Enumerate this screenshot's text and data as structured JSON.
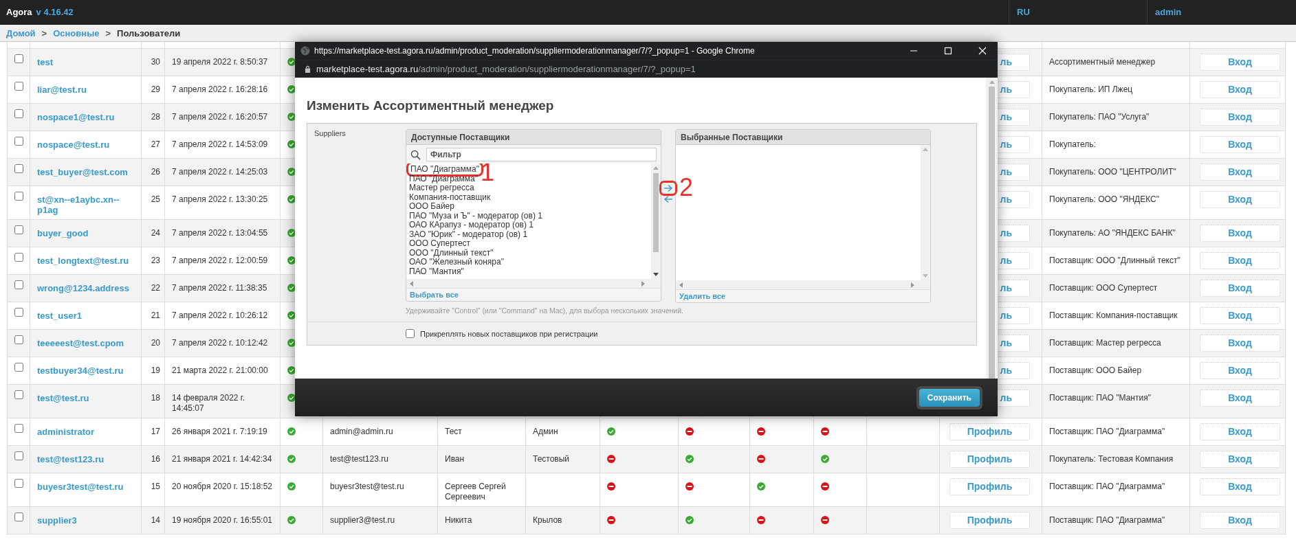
{
  "app": {
    "name": "Agora",
    "version": "v 4.16.42",
    "language": "RU",
    "user": "admin"
  },
  "breadcrumbs": [
    {
      "label": "Домой",
      "link": true
    },
    {
      "label": "Основные",
      "link": true
    },
    {
      "label": "Пользователи",
      "link": false
    }
  ],
  "breadcrumb_separator": ">",
  "users": [
    {
      "kind": "covered",
      "checked": false,
      "name": "test",
      "id": "30",
      "date": "19 апреля 2022 г. 8:50:37",
      "active": true,
      "profile": "ль",
      "role": "Ассортиментный менеджер",
      "login": "Вход"
    },
    {
      "kind": "covered",
      "checked": false,
      "name": "liar@test.ru",
      "id": "29",
      "date": "7 апреля 2022 г. 16:28:16",
      "active": true,
      "profile": "ль",
      "role": "Покупатель: ИП Лжец",
      "login": "Вход"
    },
    {
      "kind": "covered",
      "checked": false,
      "name": "nospace1@test.ru",
      "id": "28",
      "date": "7 апреля 2022 г. 16:20:57",
      "active": true,
      "profile": "ль",
      "role": "Покупатель: ПАО \"Услуга\"",
      "login": "Вход"
    },
    {
      "kind": "covered",
      "checked": false,
      "name": "nospace@test.ru",
      "id": "27",
      "date": "7 апреля 2022 г. 14:53:09",
      "active": true,
      "profile": "ль",
      "role": "Покупатель:",
      "login": "Вход"
    },
    {
      "kind": "covered",
      "checked": false,
      "name": "test_buyer@test.com",
      "id": "26",
      "date": "7 апреля 2022 г. 14:25:03",
      "active": true,
      "profile": "ль",
      "role": "Покупатель: ООО \"ЦЕНТРОЛИТ\"",
      "login": "Вход"
    },
    {
      "kind": "covered",
      "checked": false,
      "name": "st@xn--e1aybc.xn--p1ag",
      "id": "25",
      "date": "7 апреля 2022 г. 13:30:25",
      "active": true,
      "profile": "ль",
      "role": "Покупатель: ООО \"ЯНДЕКС\"",
      "login": "Вход"
    },
    {
      "kind": "covered",
      "checked": false,
      "name": "buyer_good",
      "id": "24",
      "date": "7 апреля 2022 г. 13:04:55",
      "active": true,
      "profile": "ль",
      "role": "Покупатель: АО \"ЯНДЕКС БАНК\"",
      "login": "Вход"
    },
    {
      "kind": "covered",
      "checked": false,
      "name": "test_longtext@test.ru",
      "id": "23",
      "date": "7 апреля 2022 г. 12:00:59",
      "active": true,
      "profile": "ль",
      "role": "Поставщик: ООО \"Длинный текст\"",
      "login": "Вход"
    },
    {
      "kind": "covered",
      "checked": false,
      "name": "wrong@1234.address",
      "id": "22",
      "date": "7 апреля 2022 г. 11:38:35",
      "active": true,
      "profile": "ль",
      "role": "Поставщик: ООО Супертест",
      "login": "Вход"
    },
    {
      "kind": "covered",
      "checked": false,
      "name": "test_user1",
      "id": "21",
      "date": "7 апреля 2022 г. 10:26:12",
      "active": true,
      "profile": "ль",
      "role": "Поставщик: Компания-поставщик",
      "login": "Вход"
    },
    {
      "kind": "covered",
      "checked": false,
      "name": "teeeeest@test.cpom",
      "id": "20",
      "date": "7 апреля 2022 г. 10:12:42",
      "active": true,
      "profile": "ль",
      "role": "Поставщик: Мастер регресса",
      "login": "Вход"
    },
    {
      "kind": "covered",
      "checked": false,
      "name": "testbuyer34@test.ru",
      "id": "19",
      "date": "21 марта 2022 г. 21:00:00",
      "active": true,
      "profile": "ль",
      "role": "Поставщик: ООО Байер",
      "login": "Вход"
    },
    {
      "kind": "covered",
      "checked": false,
      "name": "test@test.ru",
      "id": "18",
      "date": "14 февраля 2022 г. 14:45:07",
      "active": true,
      "profile": "ль",
      "role": "Поставщик: ПАО \"Мантия\"",
      "login": "Вход"
    },
    {
      "kind": "full",
      "checked": false,
      "name": "administrator",
      "id": "17",
      "date": "26 января 2021 г. 7:19:19",
      "active": true,
      "email": "admin@admin.ru",
      "first_name": "Тест",
      "last_name": "Админ",
      "flags": [
        true,
        false,
        false,
        false
      ],
      "profile": "Профиль",
      "role": "Поставщик: ПАО \"Диаграмма\"",
      "login": "Вход"
    },
    {
      "kind": "full",
      "checked": false,
      "name": "test@test123.ru",
      "id": "16",
      "date": "21 января 2021 г. 14:42:34",
      "active": true,
      "email": "test@test123.ru",
      "first_name": "Иван",
      "last_name": "Тестовый",
      "flags": [
        false,
        true,
        false,
        true
      ],
      "profile": "Профиль",
      "role": "Покупатель: Тестовая Компания",
      "login": "Вход"
    },
    {
      "kind": "full",
      "checked": false,
      "name": "buyesr3test@test.ru",
      "id": "15",
      "date": "20 ноября 2020 г. 15:18:52",
      "active": true,
      "email": "buyesr3test@test.ru",
      "first_name": "Сергеев Сергей Сергеевич",
      "flags": [
        false,
        false,
        true,
        false
      ],
      "profile": "Профиль",
      "role": "Поставщик: ПАО \"Диаграмма\"",
      "login": "Вход"
    },
    {
      "kind": "full",
      "checked": false,
      "name": "supplier3",
      "id": "14",
      "date": "19 ноября 2020 г. 16:55:01",
      "active": true,
      "email": "supplier3@test.ru",
      "first_name": "Никита",
      "last_name": "Крылов",
      "flags": [
        false,
        true,
        false,
        false
      ],
      "profile": "Профиль",
      "role": "Поставщик: ПАО \"Диаграмма\"",
      "login": "Вход"
    }
  ],
  "popup": {
    "window_title": "https://marketplace-test.agora.ru/admin/product_moderation/suppliermoderationmanager/7/?_popup=1 - Google Chrome",
    "url_host": "marketplace-test.agora.ru",
    "url_path": "/admin/product_moderation/suppliermoderationmanager/7/?_popup=1",
    "heading": "Изменить Ассортиментный менеджер",
    "field_label": "Suppliers",
    "available": {
      "title": "Доступные Поставщики",
      "filter_placeholder": "Фильтр",
      "action": "Выбрать все",
      "items": [
        {
          "label": "ПАО \"Диаграмма\"",
          "annotation": "1"
        },
        {
          "label": "ПАО \"Диаграмма\""
        },
        {
          "label": "Мастер регресса"
        },
        {
          "label": "Компания-поставщик"
        },
        {
          "label": "ООО Байер"
        },
        {
          "label": "ПАО \"Муза и Ъ\" - модератор (ов) 1"
        },
        {
          "label": "ОАО КАрапуз - модератор (ов) 1"
        },
        {
          "label": "ЗАО \"Юрик\" - модератор (ов) 1"
        },
        {
          "label": "ООО Супертест"
        },
        {
          "label": "ООО \"Длинный текст\""
        },
        {
          "label": "ОАО \"Железный коняра\""
        },
        {
          "label": "ПАО \"Мантия\""
        }
      ]
    },
    "move_annotation": "2",
    "chosen": {
      "title": "Выбранные Поставщики",
      "action": "Удалить все"
    },
    "help": "Удерживайте \"Control\" (или \"Command\" на Mac), для выбора нескольких значений.",
    "auto_attach": {
      "label": "Прикреплять новых поставщиков при регистрации",
      "checked": false
    },
    "save": "Сохранить"
  }
}
